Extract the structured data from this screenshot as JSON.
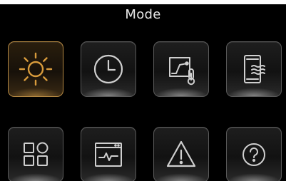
{
  "header": {
    "title": "Mode"
  },
  "colors": {
    "accent": "#d89b3c",
    "icon": "#cfcfcf",
    "tile_border": "#5a5a5a"
  },
  "tiles": [
    {
      "icon": "sun-icon",
      "selected": true
    },
    {
      "icon": "clock-icon",
      "selected": false
    },
    {
      "icon": "thermostat-curve-icon",
      "selected": false
    },
    {
      "icon": "phone-waves-icon",
      "selected": false
    },
    {
      "icon": "apps-grid-icon",
      "selected": false
    },
    {
      "icon": "monitor-pulse-icon",
      "selected": false
    },
    {
      "icon": "warning-icon",
      "selected": false
    },
    {
      "icon": "help-icon",
      "selected": false
    }
  ]
}
